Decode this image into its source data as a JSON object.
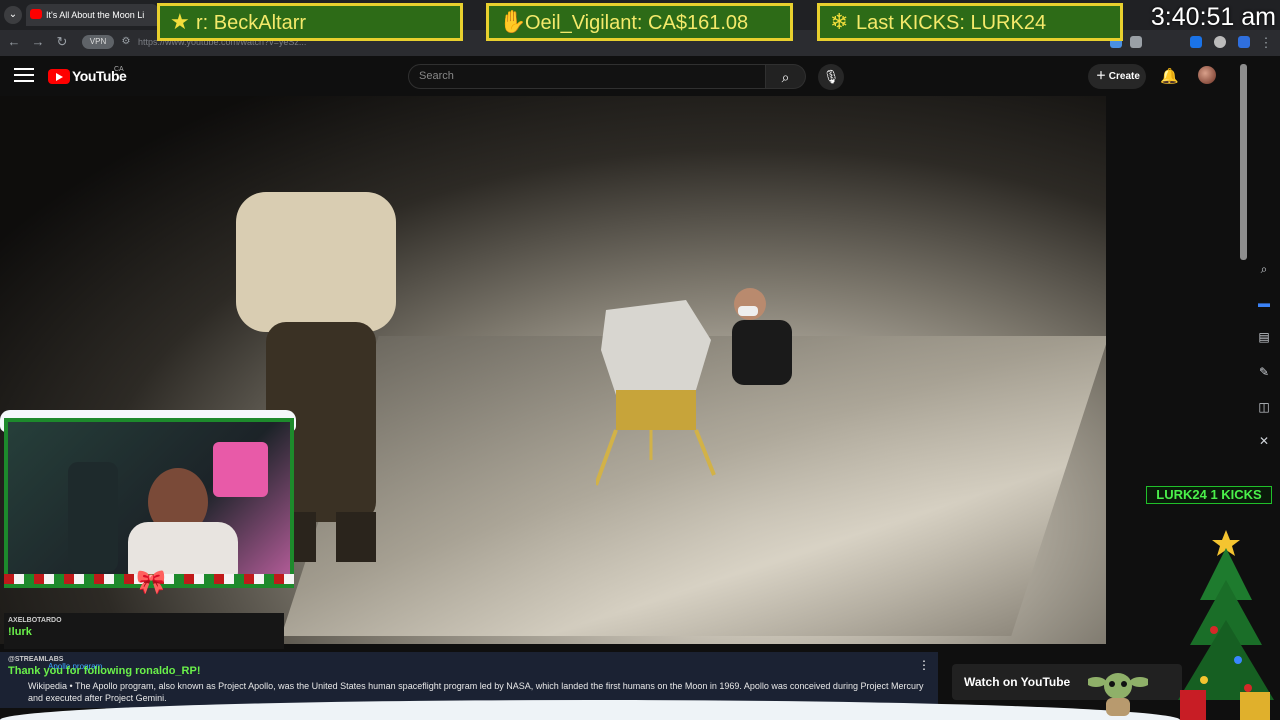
{
  "browser": {
    "tab_title": "It's All About the Moon Li",
    "url": "https://www.youtube.com/watch?v=yeSz...",
    "vpn_label": "VPN",
    "menu_icon": "chevron-down-icon"
  },
  "overlay": {
    "banner1": {
      "icon": "star-icon",
      "text": "r: BeckAltarr"
    },
    "banner2": {
      "icon": "handshake-icon",
      "text": "Oeil_Vigilant: CA$161.08"
    },
    "banner3": {
      "icon": "snowflake-icon",
      "text": "Last KICKS: LURK24"
    },
    "clock": "3:40:51 am",
    "kicks_label": "LURK24  1 KICKS"
  },
  "youtube": {
    "logo_text": "YouTube",
    "country": "CA",
    "search_placeholder": "Search",
    "create_label": "Create",
    "watch_label": "Watch on YouTube"
  },
  "chat": {
    "msg1_user": "AXELBOTARDO",
    "msg1_text": "!lurk",
    "msg2_user": "@STREAMLABS",
    "msg2_text": "Thank you for following ronaldo_RP!"
  },
  "wiki": {
    "link": "Apollo program",
    "text": "Wikipedia • The Apollo program, also known as Project Apollo, was the United States human spaceflight program led by NASA, which landed the first humans on the Moon in 1969. Apollo was conceived during Project Mercury and executed after Project Gemini."
  },
  "colors": {
    "banner_bg": "#2d6b17",
    "banner_border": "#e8d02e",
    "kicks_green": "#4af04a",
    "youtube_red": "#ff0000"
  }
}
